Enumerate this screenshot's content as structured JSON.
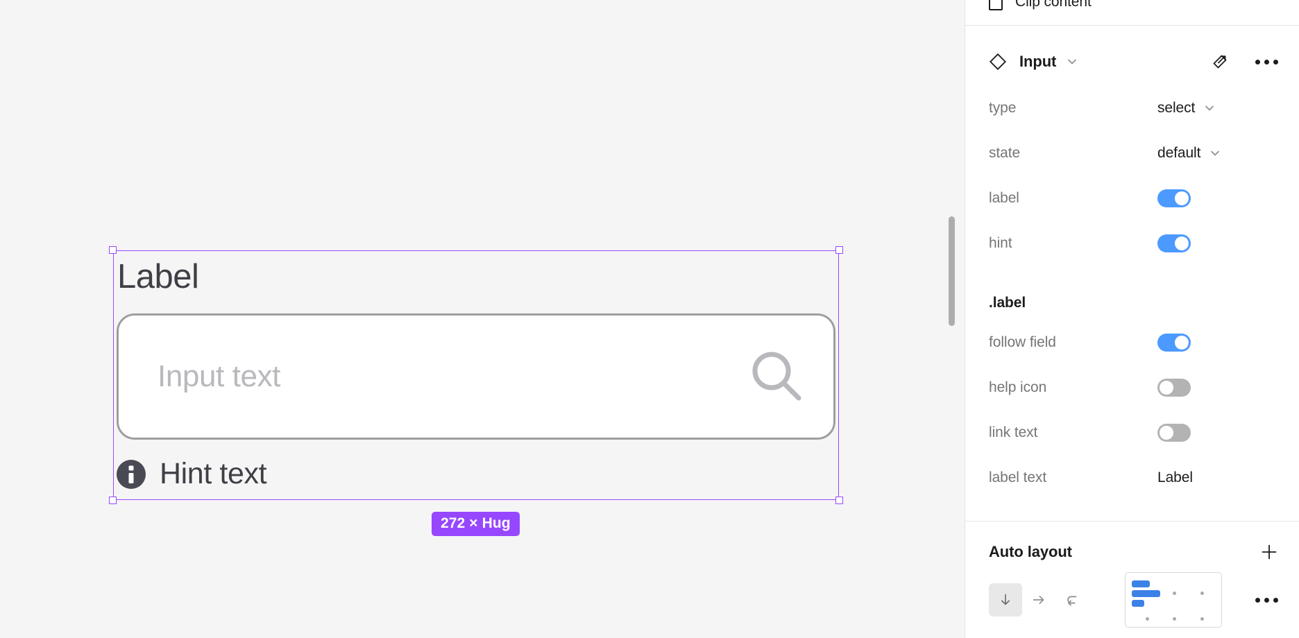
{
  "canvas": {
    "component": {
      "label_text": "Label",
      "placeholder": "Input text",
      "hint_text": "Hint text",
      "search_icon": "search-icon",
      "info_icon": "info-circle-icon"
    },
    "size_badge": "272 × Hug",
    "selection_color": "#9747ff"
  },
  "panel": {
    "clip_content": {
      "label": "Clip content",
      "checked": false
    },
    "instance": {
      "icon": "component-instance-diamond-icon",
      "name": "Input",
      "chevron": "chevron-down-icon",
      "goto_main": "go-to-main-component-icon",
      "more": "more-options-icon"
    },
    "properties": [
      {
        "name": "type",
        "kind": "select",
        "value": "select"
      },
      {
        "name": "state",
        "kind": "select",
        "value": "default"
      },
      {
        "name": "label",
        "kind": "toggle",
        "value": "on"
      },
      {
        "name": "hint",
        "kind": "toggle",
        "value": "on"
      }
    ],
    "label_group": {
      "heading": ".label",
      "properties": [
        {
          "name": "follow field",
          "kind": "toggle",
          "value": "on"
        },
        {
          "name": "help icon",
          "kind": "toggle",
          "value": "off"
        },
        {
          "name": "link text",
          "kind": "toggle",
          "value": "off"
        },
        {
          "name": "label text",
          "kind": "text",
          "value": "Label"
        }
      ]
    },
    "auto_layout": {
      "title": "Auto layout",
      "add": "plus-icon",
      "directions": [
        {
          "name": "vertical",
          "icon": "arrow-down-icon",
          "active": true
        },
        {
          "name": "horizontal",
          "icon": "arrow-right-icon",
          "active": false
        },
        {
          "name": "wrap",
          "icon": "wrap-arrow-icon",
          "active": false
        }
      ],
      "alignment": "top-left",
      "more": "more-options-icon",
      "accent_color": "#3c82e6"
    }
  }
}
